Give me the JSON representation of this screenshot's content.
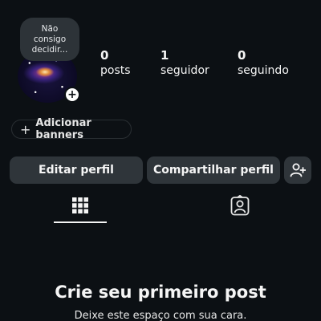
{
  "profile": {
    "note": "Não\nconsigo\ndecidir...",
    "add_story_symbol": "+",
    "stats": [
      {
        "value": "0",
        "label": "posts"
      },
      {
        "value": "1",
        "label": "seguidor"
      },
      {
        "value": "0",
        "label": "seguindo"
      }
    ]
  },
  "banners": {
    "plus": "+",
    "label": "Adicionar banners"
  },
  "actions": {
    "edit_label": "Editar perfil",
    "share_label": "Compartilhar perfil",
    "add_person_icon": "add-person-icon"
  },
  "tabs": [
    {
      "icon": "grid-icon",
      "active": true
    },
    {
      "icon": "tagged-icon",
      "active": false
    }
  ],
  "empty_state": {
    "title": "Crie seu primeiro post",
    "subtitle": "Deixe este espaço com sua cara."
  },
  "colors": {
    "background": "#0c1014",
    "button": "#2f353a",
    "text": "#f5f5f5"
  }
}
